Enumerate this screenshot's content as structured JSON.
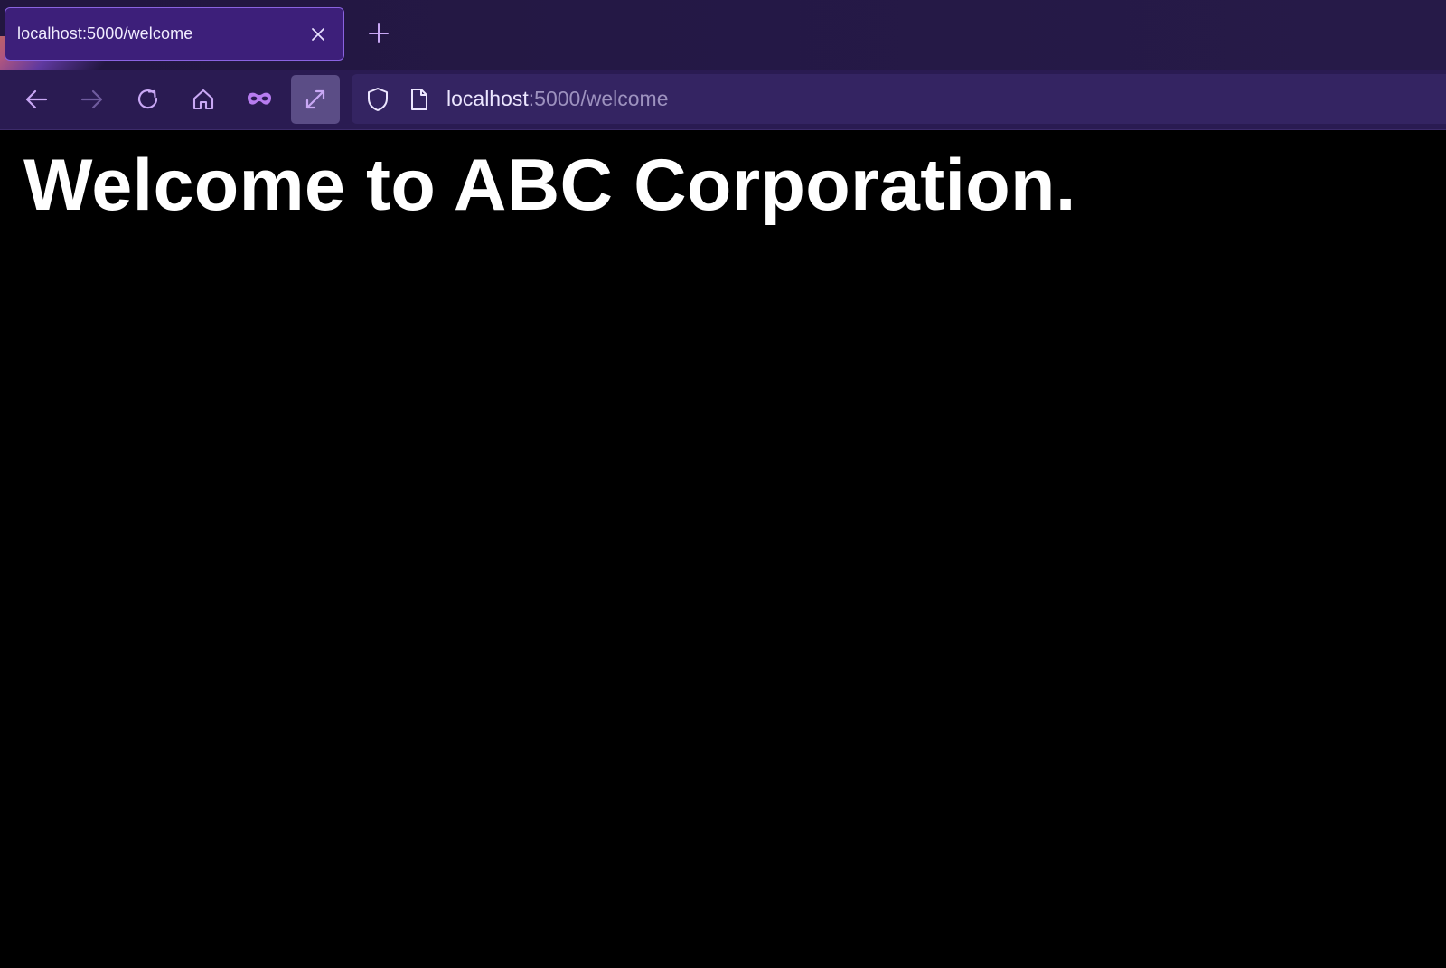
{
  "tab": {
    "title": "localhost:5000/welcome"
  },
  "toolbar": {
    "back": "arrow-left-icon",
    "forward": "arrow-right-icon",
    "reload": "reload-icon",
    "home": "home-icon",
    "private": "mask-icon",
    "fullscreen": "expand-icon"
  },
  "urlbar": {
    "host": "localhost",
    "rest": ":5000/welcome"
  },
  "page": {
    "heading": "Welcome to ABC Corporation."
  },
  "colors": {
    "accent": "#b77cf0",
    "tab_bg": "#3d1f7a",
    "toolbar_bg": "#2a1b52",
    "page_bg": "#000000"
  }
}
